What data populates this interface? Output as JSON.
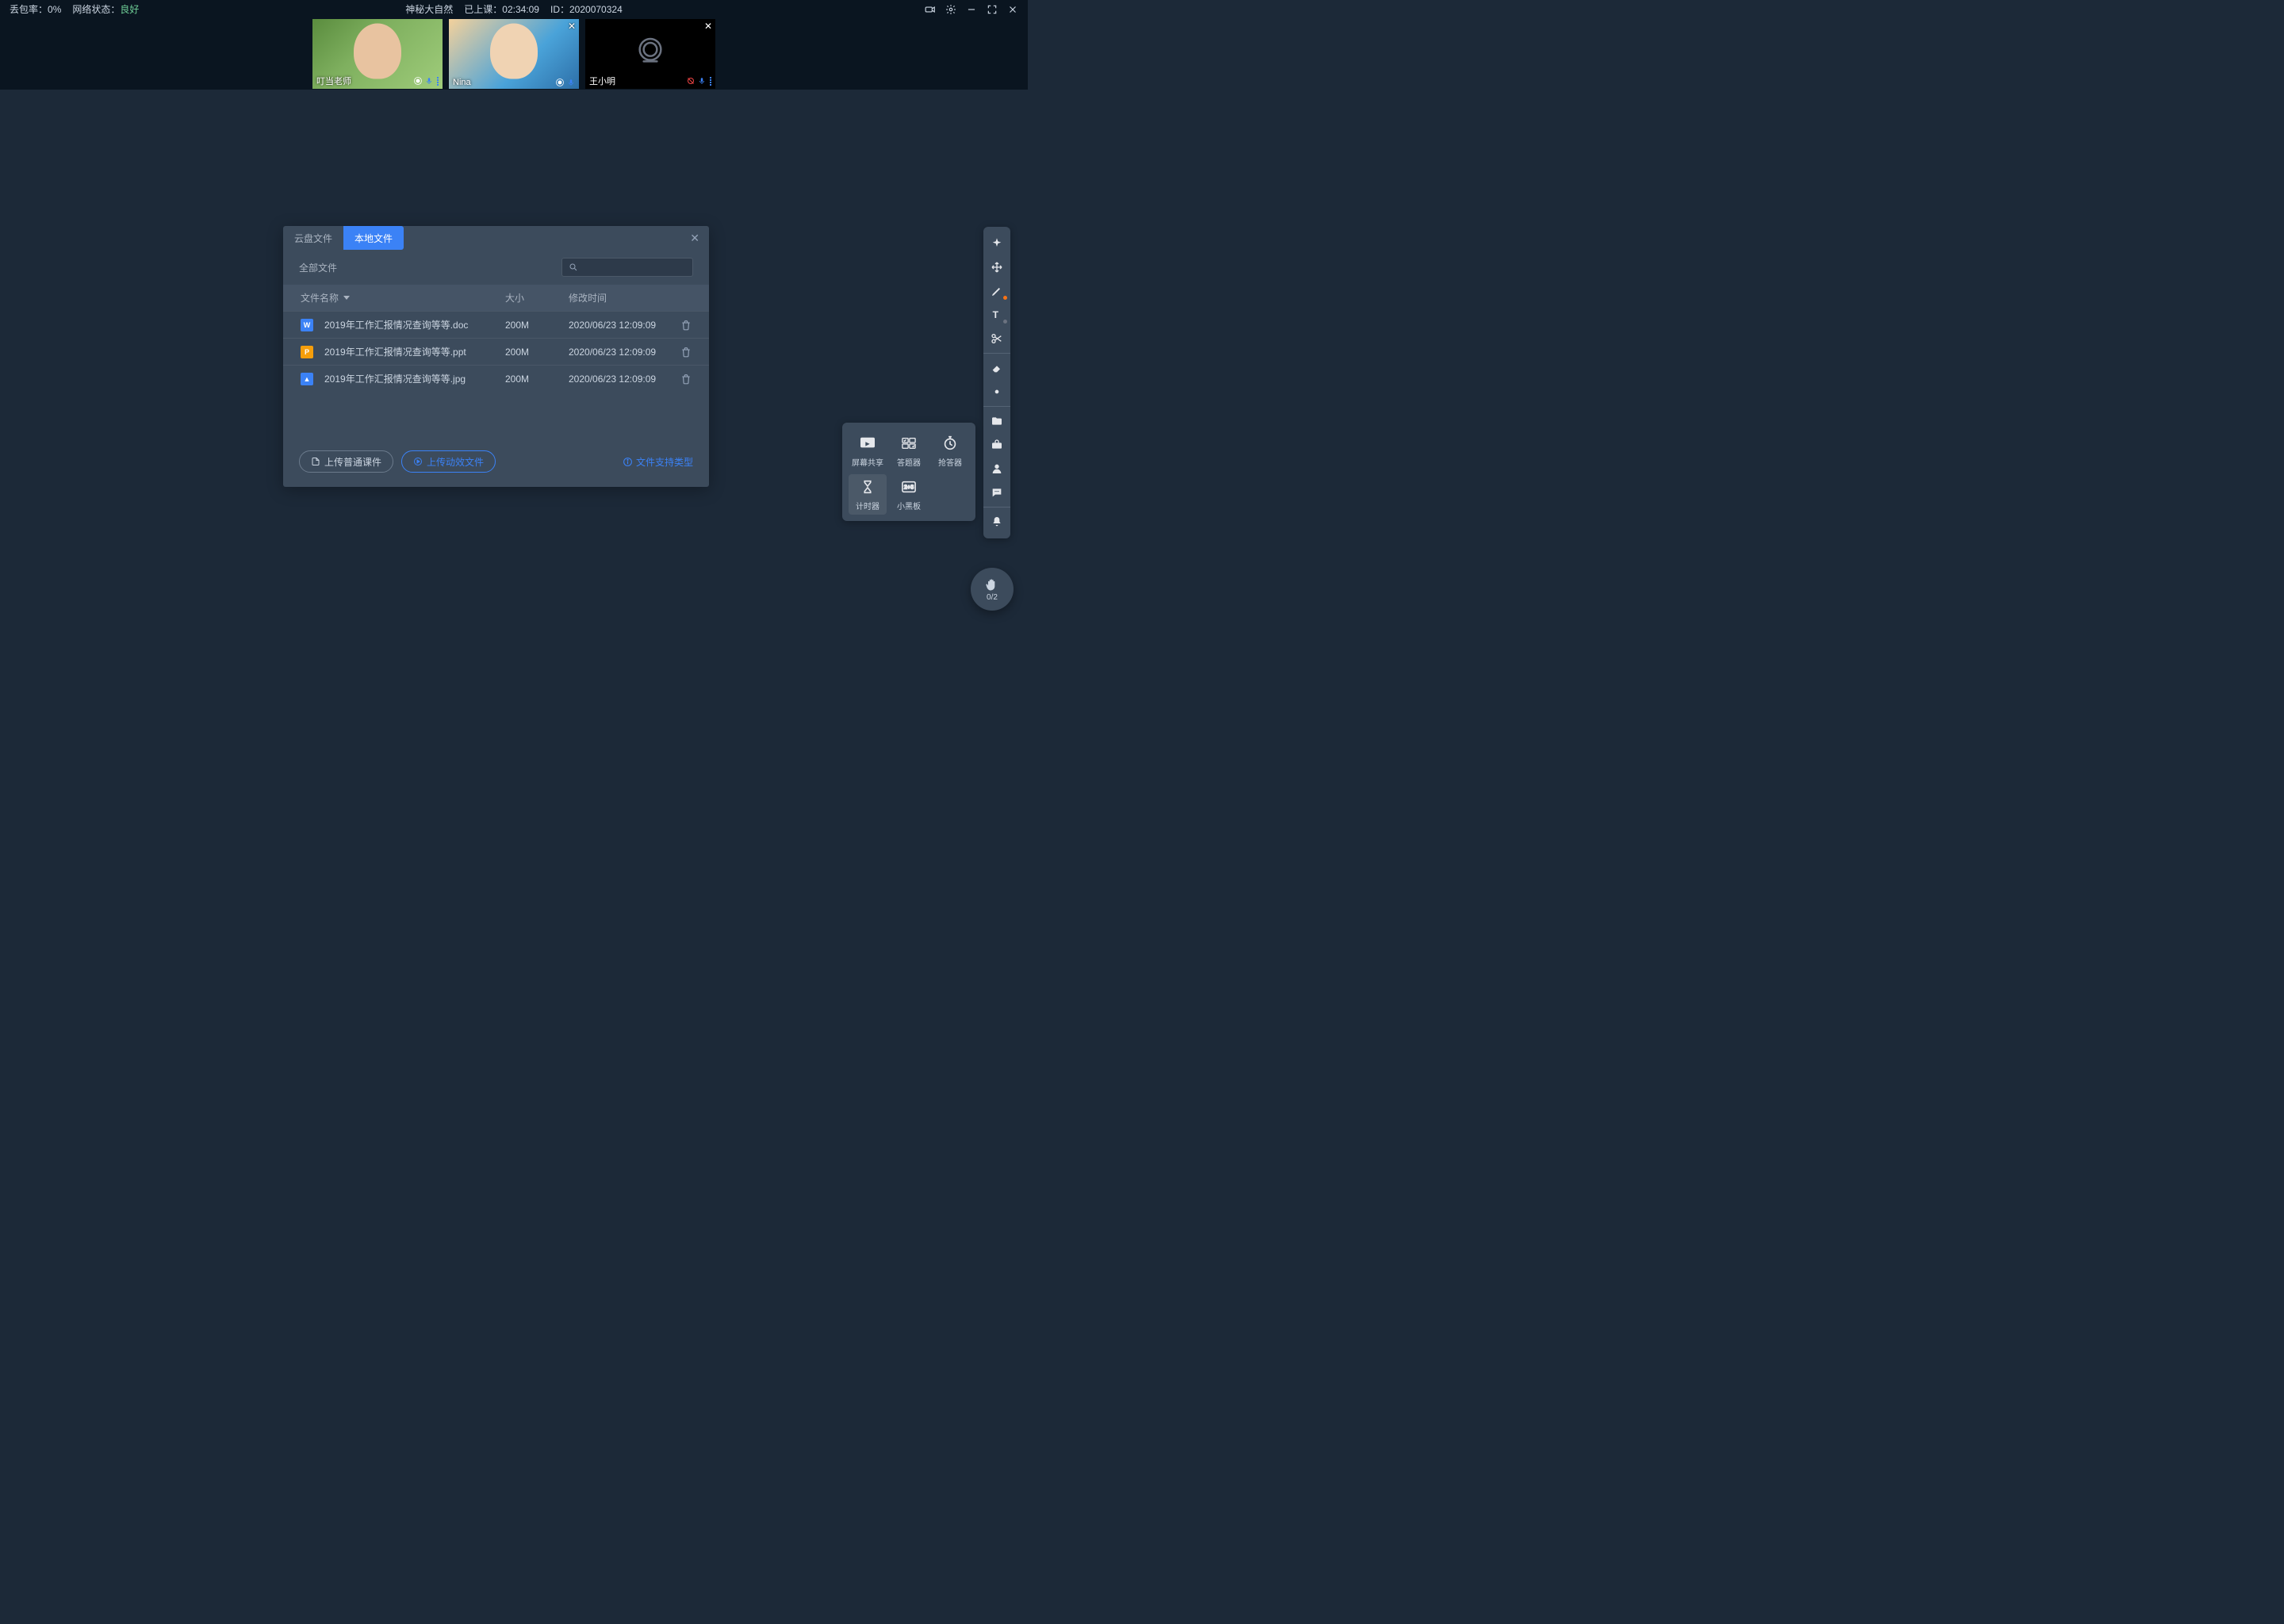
{
  "header": {
    "packet_loss_label": "丢包率：",
    "packet_loss_value": "0%",
    "net_label": "网络状态：",
    "net_value": "良好",
    "title": "神秘大自然",
    "elapsed_label": "已上课：",
    "elapsed_value": "02:34:09",
    "id_label": "ID：",
    "id_value": "2020070324"
  },
  "participants": [
    {
      "name": "叮当老师"
    },
    {
      "name": "Nina"
    },
    {
      "name": "王小明"
    }
  ],
  "dialog": {
    "tabs": {
      "cloud": "云盘文件",
      "local": "本地文件"
    },
    "all_files": "全部文件",
    "columns": {
      "name": "文件名称",
      "size": "大小",
      "time": "修改时间"
    },
    "files": [
      {
        "icon": "W",
        "type": "doc",
        "name": "2019年工作汇报情况查询等等.doc",
        "size": "200M",
        "time": "2020/06/23 12:09:09"
      },
      {
        "icon": "P",
        "type": "ppt",
        "name": "2019年工作汇报情况查询等等.ppt",
        "size": "200M",
        "time": "2020/06/23 12:09:09"
      },
      {
        "icon": "▲",
        "type": "jpg",
        "name": "2019年工作汇报情况查询等等.jpg",
        "size": "200M",
        "time": "2020/06/23 12:09:09"
      }
    ],
    "upload_normal": "上传普通课件",
    "upload_dynamic": "上传动效文件",
    "support_types": "文件支持类型"
  },
  "tool_popup": {
    "screen_share": "屏幕共享",
    "answer": "答题器",
    "responder": "抢答器",
    "timer": "计时器",
    "blackboard": "小黑板"
  },
  "hand": {
    "count": "0/2"
  }
}
